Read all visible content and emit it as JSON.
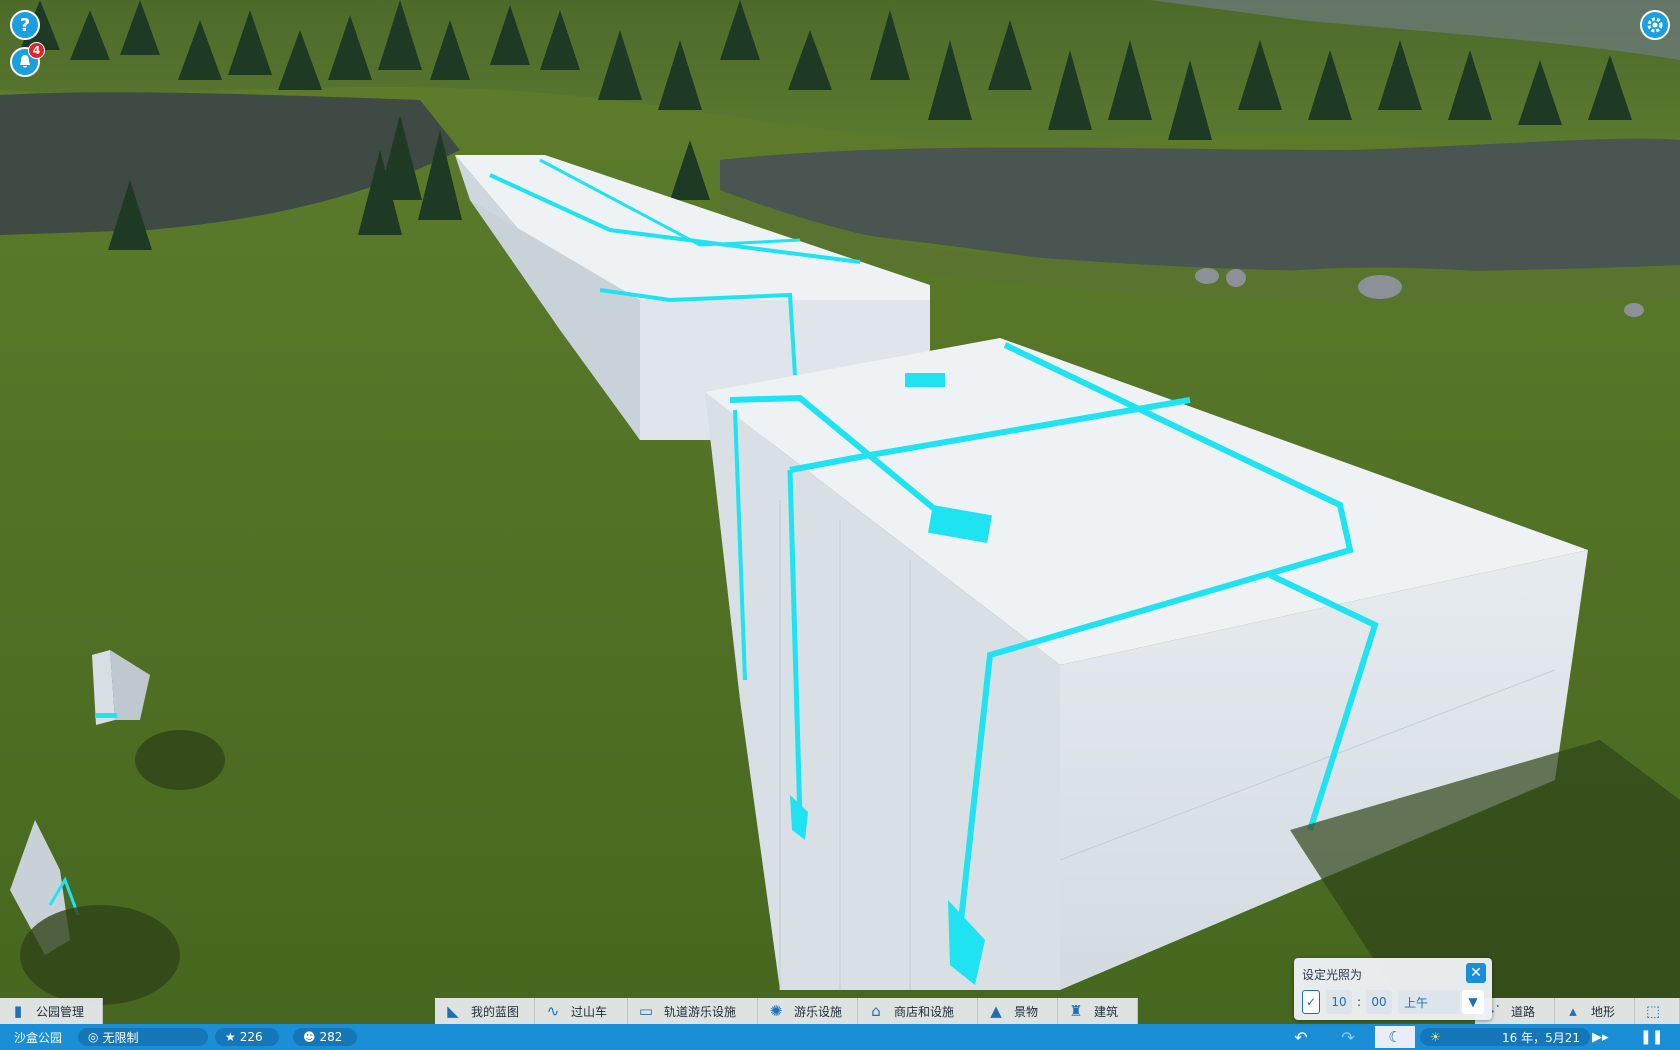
{
  "top": {
    "help_glyph": "?",
    "notification_count": "4"
  },
  "toolbar": {
    "park_management": "公园管理",
    "blueprints": "我的蓝图",
    "coasters": "过山车",
    "track_rides": "轨道游乐设施",
    "rides": "游乐设施",
    "shops": "商店和设施",
    "scenery": "景物",
    "buildings": "建筑",
    "paths": "道路",
    "terrain": "地形"
  },
  "status": {
    "park_name": "沙盒公园",
    "money": "无限制",
    "rating": "226",
    "guests": "282",
    "date": "16 年，5月21"
  },
  "lighting": {
    "title": "设定光照为",
    "hour": "10",
    "separator": ":",
    "minute": "00",
    "period": "上午"
  },
  "colors": {
    "accent": "#1a8fd8",
    "neon": "#1fe3f0",
    "grass": "#4e6e23"
  }
}
